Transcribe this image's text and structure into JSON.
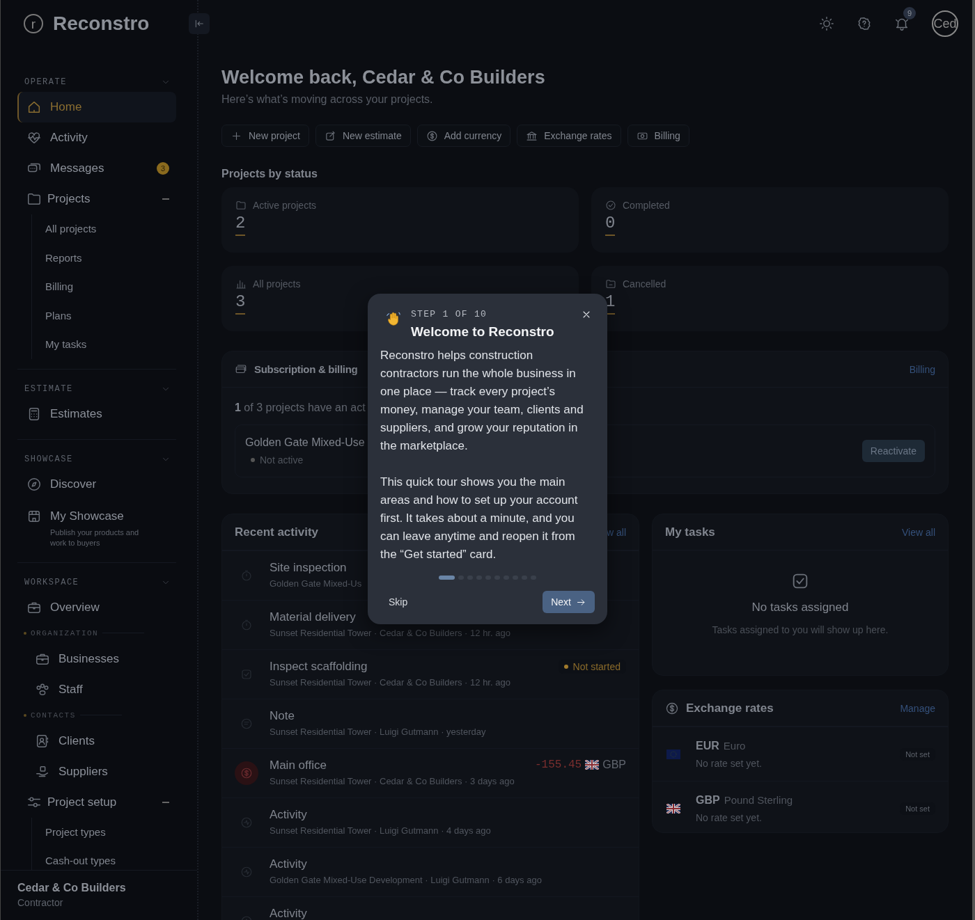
{
  "app": {
    "logo_letter": "r",
    "name": "Reconstro"
  },
  "header": {
    "notification_count": "9",
    "avatar_text": "Ced"
  },
  "sidebar": {
    "sections": [
      {
        "label": "OPERATE",
        "expanded": true,
        "items": [
          {
            "kind": "item",
            "label": "Home",
            "selected": true
          },
          {
            "kind": "item",
            "label": "Activity",
            "selected": false
          },
          {
            "kind": "item",
            "label": "Messages",
            "selected": false,
            "badge": "3"
          },
          {
            "kind": "group",
            "label": "Projects",
            "selected": false,
            "expanded": true,
            "children": [
              {
                "label": "All projects",
                "selected": false
              },
              {
                "label": "Reports",
                "selected": false
              },
              {
                "label": "Billing",
                "selected": false
              },
              {
                "label": "Plans",
                "selected": false
              },
              {
                "label": "My tasks",
                "selected": false
              }
            ]
          }
        ]
      },
      {
        "label": "ESTIMATE",
        "expanded": true,
        "items": [
          {
            "kind": "item",
            "label": "Estimates",
            "selected": false
          }
        ]
      },
      {
        "label": "SHOWCASE",
        "expanded": true,
        "items": [
          {
            "kind": "item",
            "label": "Discover",
            "selected": false
          },
          {
            "kind": "item",
            "label": "My Showcase",
            "selected": false,
            "description": "Publish your products and work to buyers"
          }
        ]
      },
      {
        "label": "WORKSPACE",
        "expanded": true,
        "items": [
          {
            "kind": "item",
            "label": "Overview",
            "selected": false
          },
          {
            "kind": "subheading",
            "label": "ORGANIZATION"
          },
          {
            "kind": "subitem",
            "label": "Businesses",
            "selected": false
          },
          {
            "kind": "subitem",
            "label": "Staff",
            "selected": false
          },
          {
            "kind": "subheading",
            "label": "CONTACTS"
          },
          {
            "kind": "subitem",
            "label": "Clients",
            "selected": false
          },
          {
            "kind": "subitem",
            "label": "Suppliers",
            "selected": false
          },
          {
            "kind": "group",
            "label": "Project setup",
            "selected": false,
            "expanded": true,
            "children": [
              {
                "label": "Project types",
                "selected": false
              },
              {
                "label": "Cash-out types",
                "selected": false
              }
            ]
          }
        ]
      }
    ],
    "footer": {
      "name": "Cedar & Co Builders",
      "role": "Contractor"
    }
  },
  "page": {
    "title": "Welcome back, Cedar & Co Builders",
    "subtitle": "Here’s what’s moving across your projects."
  },
  "quick_actions": [
    "New project",
    "New estimate",
    "Add currency",
    "Exchange rates",
    "Billing"
  ],
  "projects_by_status": {
    "title": "Projects by status",
    "cards": [
      {
        "label": "Active projects",
        "value": "2"
      },
      {
        "label": "Completed",
        "value": "0"
      },
      {
        "label": "All projects",
        "value": "3"
      },
      {
        "label": "Cancelled",
        "value": "1"
      }
    ]
  },
  "subscription": {
    "title": "Subscription & billing",
    "link": "Billing",
    "summary": "**1** of 3 projects have an act",
    "project": {
      "name": "Golden Gate Mixed-Use",
      "status": "Not active"
    },
    "button": "Reactivate"
  },
  "recent_activity": {
    "title": "Recent activity",
    "link": "w all",
    "rows": [
      {
        "kind": "timer",
        "title": "Site inspection",
        "meta": "Golden Gate Mixed-Us"
      },
      {
        "kind": "timer",
        "title": "Material delivery",
        "meta": "Sunset Residential Tower · Cedar & Co Builders · 12 hr. ago"
      },
      {
        "kind": "task",
        "title": "Inspect scaffolding",
        "meta": "Sunset Residential Tower · Cedar & Co Builders · 12 hr. ago",
        "status": {
          "label": "Not started",
          "color": "#a07a2c"
        }
      },
      {
        "kind": "note",
        "title": "Note",
        "meta": "Sunset Residential Tower · Luigi Gutmann · yesterday"
      },
      {
        "kind": "expense",
        "title": "Main office",
        "meta": "Sunset Residential Tower · Cedar & Co Builders · 3 days ago",
        "amount": "-155.45",
        "currency": "GBP"
      },
      {
        "kind": "activity",
        "title": "Activity",
        "meta": "Sunset Residential Tower · Luigi Gutmann · 4 days ago"
      },
      {
        "kind": "activity",
        "title": "Activity",
        "meta": "Golden Gate Mixed-Use Development · Luigi Gutmann · 6 days ago"
      },
      {
        "kind": "activity",
        "title": "Activity"
      }
    ]
  },
  "my_tasks": {
    "title": "My tasks",
    "link": "View all",
    "empty_title": "No tasks assigned",
    "empty_text": "Tasks assigned to you will show up here."
  },
  "exchange_rates": {
    "title": "Exchange rates",
    "link": "Manage",
    "rows": [
      {
        "code": "EUR",
        "name": "Euro",
        "note": "No rate set yet.",
        "status": "Not set"
      },
      {
        "code": "GBP",
        "name": "Pound Sterling",
        "note": "No rate set yet.",
        "status": "Not set"
      }
    ]
  },
  "tour": {
    "step": "STEP 1 OF 10",
    "title": "Welcome to Reconstro",
    "paragraphs": [
      "Reconstro helps construction contractors run the whole business in one place — track every project’s money, manage your team, clients and suppliers, and grow your reputation in the marketplace.",
      "This quick tour shows you the main areas and how to set up your account first. It takes about a minute, and you can leave anytime and reopen it from the “Get started” card."
    ],
    "dots": [
      {
        "selected": true
      },
      {
        "selected": false
      },
      {
        "selected": false
      },
      {
        "selected": false
      },
      {
        "selected": false
      },
      {
        "selected": false
      },
      {
        "selected": false
      },
      {
        "selected": false
      },
      {
        "selected": false
      },
      {
        "selected": false
      }
    ],
    "skip": "Skip",
    "next": "Next"
  }
}
